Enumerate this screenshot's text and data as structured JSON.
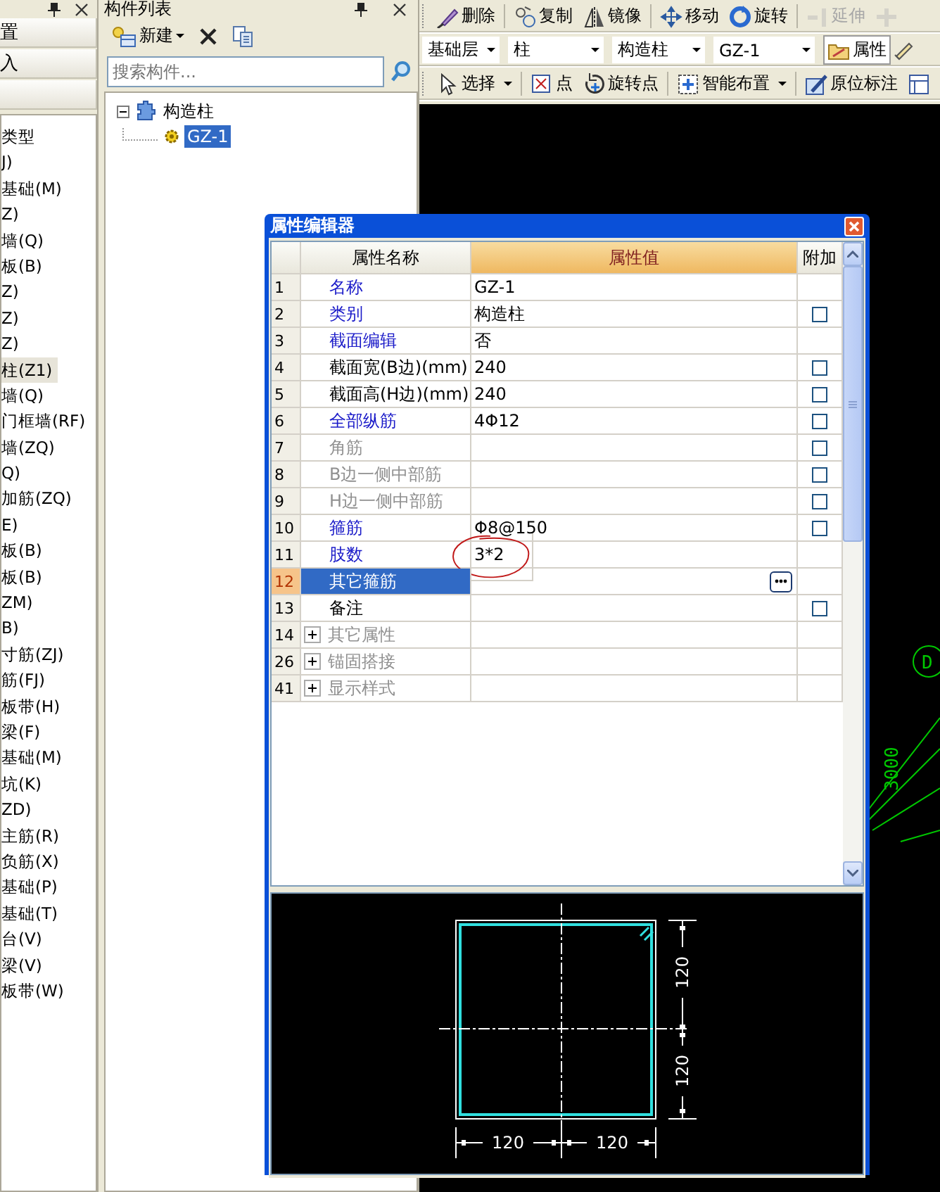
{
  "left_panel": {
    "header_buttons": [
      "置",
      "入"
    ],
    "items": [
      {
        "label": "类型",
        "selected": false
      },
      {
        "label": "J)",
        "selected": false
      },
      {
        "label": "基础(M)",
        "selected": false
      },
      {
        "label": "Z)",
        "selected": false
      },
      {
        "label": "墙(Q)",
        "selected": false
      },
      {
        "label": "板(B)",
        "selected": false
      },
      {
        "label": "Z)",
        "selected": false
      },
      {
        "label": "Z)",
        "selected": false
      },
      {
        "label": "Z)",
        "selected": false
      },
      {
        "label": "柱(Z1)",
        "selected": true
      },
      {
        "label": "墙(Q)",
        "selected": false
      },
      {
        "label": "门框墙(RF)",
        "selected": false
      },
      {
        "label": "墙(ZQ)",
        "selected": false
      },
      {
        "label": "Q)",
        "selected": false
      },
      {
        "label": "加筋(ZQ)",
        "selected": false
      },
      {
        "label": "E)",
        "selected": false
      },
      {
        "label": "板(B)",
        "selected": false
      },
      {
        "label": "板(B)",
        "selected": false
      },
      {
        "label": "ZM)",
        "selected": false
      },
      {
        "label": "B)",
        "selected": false
      },
      {
        "label": "寸筋(ZJ)",
        "selected": false
      },
      {
        "label": "筋(FJ)",
        "selected": false
      },
      {
        "label": "板带(H)",
        "selected": false
      },
      {
        "label": "梁(F)",
        "selected": false
      },
      {
        "label": "基础(M)",
        "selected": false
      },
      {
        "label": "坑(K)",
        "selected": false
      },
      {
        "label": "ZD)",
        "selected": false
      },
      {
        "label": "主筋(R)",
        "selected": false
      },
      {
        "label": "负筋(X)",
        "selected": false
      },
      {
        "label": "基础(P)",
        "selected": false
      },
      {
        "label": "基础(T)",
        "selected": false
      },
      {
        "label": "台(V)",
        "selected": false
      },
      {
        "label": "梁(V)",
        "selected": false
      },
      {
        "label": "板带(W)",
        "selected": false
      }
    ]
  },
  "component_list": {
    "title": "构件列表",
    "new_label": "新建",
    "search": {
      "placeholder": "搜索构件..."
    },
    "tree": [
      {
        "label": "构造柱",
        "expanded": true,
        "selected": false,
        "children": [
          {
            "label": "GZ-1",
            "selected": true
          }
        ]
      }
    ]
  },
  "toolbar": {
    "edit_buttons": [
      {
        "kind": "delete",
        "label": "删除",
        "disabled": false
      },
      {
        "kind": "copy",
        "label": "复制",
        "disabled": false
      },
      {
        "kind": "mirror",
        "label": "镜像",
        "disabled": false
      },
      {
        "kind": "move",
        "label": "移动",
        "disabled": false
      },
      {
        "kind": "rotate",
        "label": "旋转",
        "disabled": false
      },
      {
        "kind": "extend",
        "label": "延伸",
        "disabled": true
      },
      {
        "kind": "trim",
        "disabled": true
      }
    ],
    "selectors": [
      "基础层",
      "柱",
      "构造柱",
      "GZ-1"
    ],
    "property_button": {
      "label": "属性",
      "pressed": true
    },
    "draw_buttons": [
      {
        "kind": "select",
        "label": "选择",
        "dropdown": true
      },
      {
        "kind": "point",
        "label": "点",
        "dropdown": false
      },
      {
        "kind": "rotate_point",
        "label": "旋转点",
        "dropdown": false
      },
      {
        "kind": "smart",
        "label": "智能布置",
        "dropdown": true
      },
      {
        "kind": "in_place",
        "label": "原位标注",
        "dropdown": false
      },
      {
        "kind": "table",
        "dropdown": false
      }
    ]
  },
  "canvas": {
    "axis_label": "D",
    "dimension": "3000"
  },
  "property_editor": {
    "title": "属性编辑器",
    "columns": [
      "属性名称",
      "属性值",
      "附加"
    ],
    "rows": [
      {
        "number": "1",
        "name": "名称",
        "value": "GZ-1",
        "kind": "public",
        "selected": false,
        "circled": false
      },
      {
        "number": "2",
        "name": "类别",
        "value": "构造柱",
        "kind": "public",
        "selected": false,
        "circled": false,
        "extra_checked": false
      },
      {
        "number": "3",
        "name": "截面编辑",
        "value": "否",
        "kind": "public",
        "selected": false,
        "circled": false
      },
      {
        "number": "4",
        "name": "截面宽(B边)(mm)",
        "value": "240",
        "kind": "private",
        "selected": false,
        "circled": false,
        "extra_checked": false
      },
      {
        "number": "5",
        "name": "截面高(H边)(mm)",
        "value": "240",
        "kind": "private",
        "selected": false,
        "circled": false,
        "extra_checked": false
      },
      {
        "number": "6",
        "name": "全部纵筋",
        "value": "4Φ12",
        "kind": "public",
        "selected": false,
        "circled": false,
        "extra_checked": false
      },
      {
        "number": "7",
        "name": "角筋",
        "kind": "disabled",
        "selected": false,
        "circled": false,
        "extra_checked": false
      },
      {
        "number": "8",
        "name": "B边一侧中部筋",
        "kind": "disabled",
        "selected": false,
        "circled": false,
        "extra_checked": false
      },
      {
        "number": "9",
        "name": "H边一侧中部筋",
        "kind": "disabled",
        "selected": false,
        "circled": false,
        "extra_checked": false
      },
      {
        "number": "10",
        "name": "箍筋",
        "value": "Φ8@150",
        "kind": "public",
        "selected": false,
        "circled": false,
        "extra_checked": false
      },
      {
        "number": "11",
        "name": "肢数",
        "value": "3*2",
        "kind": "public",
        "selected": false,
        "circled": true
      },
      {
        "number": "12",
        "name": "其它箍筋",
        "kind": "private",
        "selected": true,
        "circled": false
      },
      {
        "number": "13",
        "name": "备注",
        "kind": "private",
        "selected": false,
        "circled": false,
        "extra_checked": false
      },
      {
        "number": "14",
        "name": "其它属性",
        "kind": "group",
        "selected": false,
        "circled": false
      },
      {
        "number": "26",
        "name": "锚固搭接",
        "kind": "group",
        "selected": false,
        "circled": false
      },
      {
        "number": "41",
        "name": "显示样式",
        "kind": "group",
        "selected": false,
        "circled": false
      }
    ],
    "section_dimensions": [
      "120",
      "120",
      "120",
      "120"
    ]
  }
}
